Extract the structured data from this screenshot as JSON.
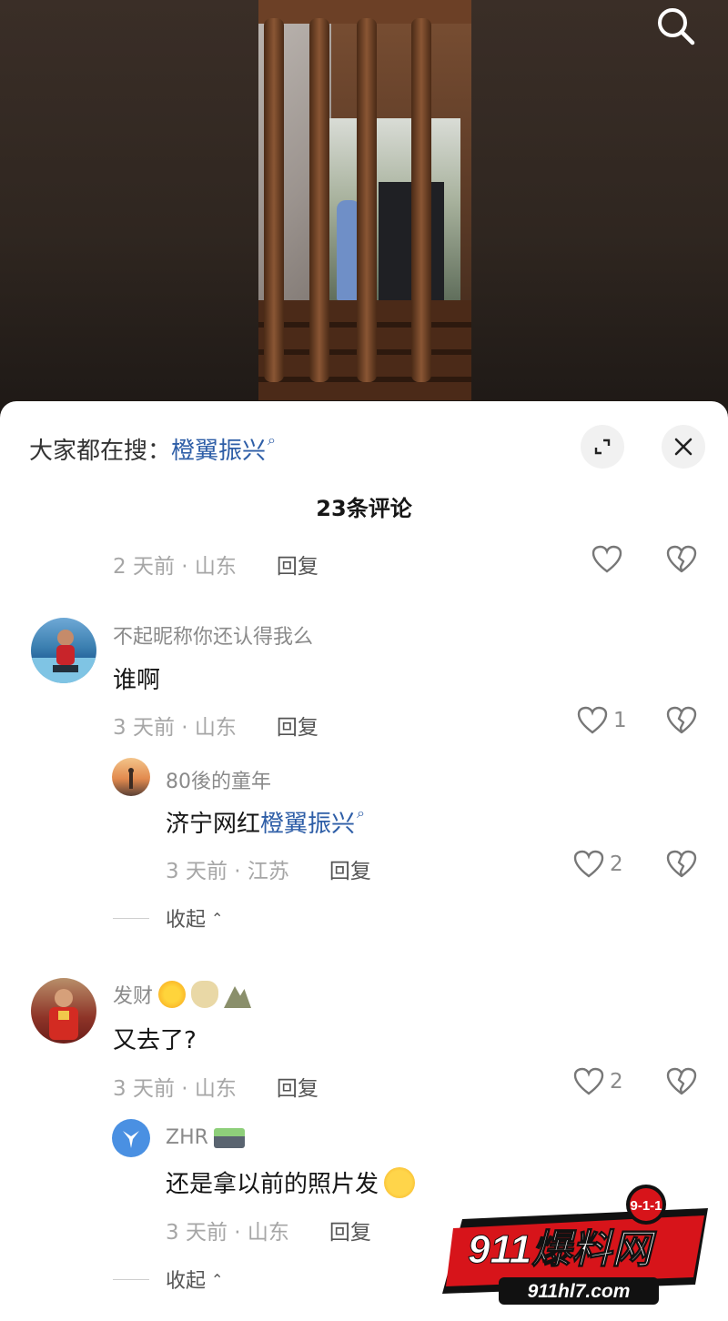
{
  "top": {
    "search_icon": "search-icon"
  },
  "sheet": {
    "hot_search_label": "大家都在搜：",
    "hot_search_keyword": "橙翼振兴",
    "comment_count": "23条评论"
  },
  "meta_first": {
    "time_loc": "2 天前 · 山东",
    "reply": "回复"
  },
  "comments": [
    {
      "username": "不起昵称你还认得我么",
      "text": "谁啊",
      "time_loc": "3 天前 · 山东",
      "reply": "回复",
      "likes": "1",
      "replies": [
        {
          "username": "80後的童年",
          "text_prefix": "济宁网红",
          "text_keyword": "橙翼振兴",
          "time_loc": "3 天前 · 江苏",
          "reply": "回复",
          "likes": "2"
        }
      ],
      "collapse_label": "收起"
    },
    {
      "username": "发财",
      "text": "又去了?",
      "time_loc": "3 天前 · 山东",
      "reply": "回复",
      "likes": "2",
      "replies": [
        {
          "username": "ZHR",
          "text": "还是拿以前的照片发",
          "time_loc": "3 天前 · 山东",
          "reply": "回复"
        }
      ],
      "collapse_label": "收起"
    }
  ],
  "watermark": {
    "badge": "9-1-1",
    "brand": "911爆料网",
    "url": "911hl7.com"
  },
  "colors": {
    "keyword": "#2e5ea7",
    "meta": "#a6a6a6",
    "brand_red": "#d7141a"
  }
}
